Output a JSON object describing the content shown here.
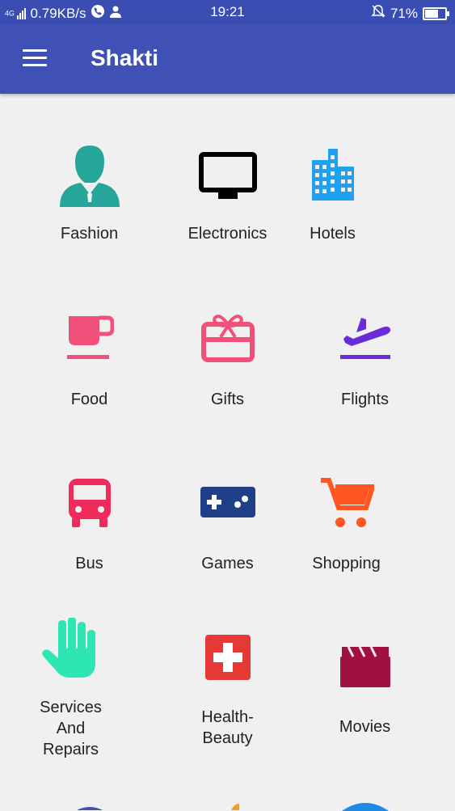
{
  "status_bar": {
    "network": "4G",
    "speed": "0.79KB/s",
    "time": "19:21",
    "battery": "71%",
    "battery_level": 0.71
  },
  "app_bar": {
    "title": "Shakti"
  },
  "categories": [
    {
      "label": "Fashion",
      "icon": "person-icon",
      "color": "#26a69a"
    },
    {
      "label": "Electronics",
      "icon": "tv-icon",
      "color": "#000000"
    },
    {
      "label": "Hotels",
      "icon": "building-icon",
      "color": "#1ea1f3"
    },
    {
      "label": "Food",
      "icon": "coffee-cup-icon",
      "color": "#f0507a"
    },
    {
      "label": "Gifts",
      "icon": "gift-card-icon",
      "color": "#f0507a"
    },
    {
      "label": "Flights",
      "icon": "flight-takeoff-icon",
      "color": "#6a2bd9"
    },
    {
      "label": "Bus",
      "icon": "bus-icon",
      "color": "#ef2b5b"
    },
    {
      "label": "Games",
      "icon": "gamepad-icon",
      "color": "#1f3f86"
    },
    {
      "label": "Shopping",
      "icon": "shopping-cart-icon",
      "color": "#ff5722"
    },
    {
      "label": "Services\nAnd\nRepairs",
      "icon": "hand-icon",
      "color": "#2ee6b3"
    },
    {
      "label": "Health-\nBeauty",
      "icon": "medical-cross-icon",
      "color": "#e53935"
    },
    {
      "label": "Movies",
      "icon": "clapperboard-icon",
      "color": "#a01040"
    }
  ]
}
